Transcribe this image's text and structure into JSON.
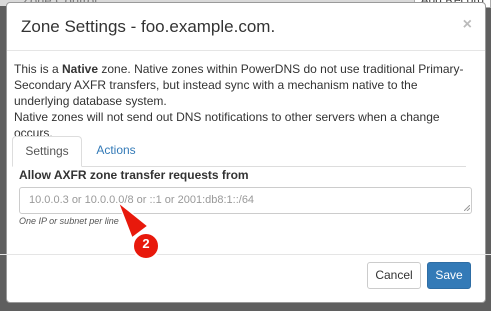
{
  "background": {
    "left_text": "Zone Control",
    "right_button": "Add Record"
  },
  "modal": {
    "title": "Zone Settings - foo.example.com.",
    "close_glyph": "×",
    "description": {
      "prefix": "This is a ",
      "bold": "Native",
      "suffix": " zone. Native zones within PowerDNS do not use traditional Primary-Secondary AXFR transfers, but instead sync with a mechanism native to the underlying database system.",
      "line2": "Native zones will not send out DNS notifications to other servers when a change occurs."
    },
    "tabs": [
      {
        "label": "Settings",
        "active": true
      },
      {
        "label": "Actions",
        "active": false
      }
    ],
    "axfr": {
      "label": "Allow AXFR zone transfer requests from",
      "value": "",
      "placeholder": "10.0.0.3 or 10.0.0.0/8 or ::1 or 2001:db8:1::/64",
      "help": "One IP or subnet per line"
    },
    "buttons": {
      "cancel": "Cancel",
      "save": "Save"
    }
  },
  "annotation": {
    "badge_number": "2",
    "color": "#e8190c"
  },
  "colors": {
    "primary": "#337ab7",
    "backdrop": "#5f5f5f"
  }
}
